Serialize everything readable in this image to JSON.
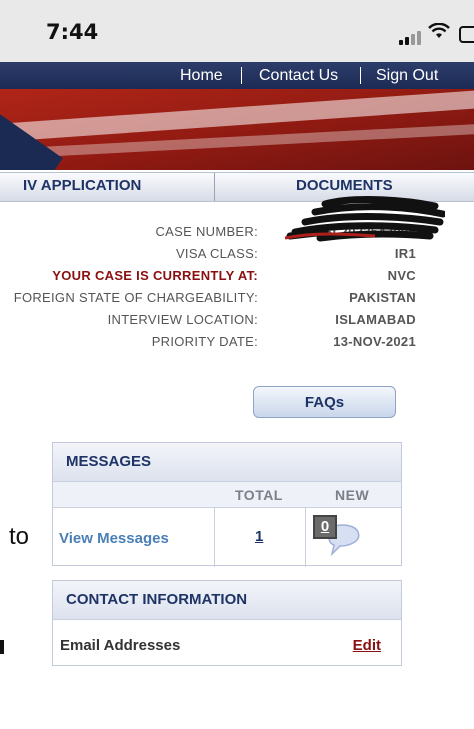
{
  "status_bar": {
    "time": "7:44"
  },
  "nav": {
    "items": [
      "Home",
      "Contact Us",
      "Sign Out"
    ]
  },
  "tabs": {
    "left": "IV APPLICATION",
    "right": "DOCUMENTS"
  },
  "case_info": {
    "case_number_label": "CASE NUMBER:",
    "case_number_value": "ISL2022543006",
    "visa_class_label": "VISA CLASS:",
    "visa_class_value": "IR1",
    "current_label": "YOUR CASE IS CURRENTLY AT:",
    "current_value": "NVC",
    "state_label": "FOREIGN STATE OF CHARGEABILITY:",
    "state_value": "PAKISTAN",
    "interview_label": "INTERVIEW LOCATION:",
    "interview_value": "ISLAMABAD",
    "priority_label": "PRIORITY DATE:",
    "priority_value": "13-NOV-2021"
  },
  "faq_button": "FAQs",
  "messages": {
    "title": "MESSAGES",
    "col_total": "TOTAL",
    "col_new": "NEW",
    "link": "View Messages",
    "total": "1",
    "new": "0"
  },
  "contact": {
    "title": "CONTACT INFORMATION",
    "email_label": "Email Addresses",
    "edit": "Edit"
  },
  "side_text": "to",
  "colors": {
    "navy": "#1f3466",
    "red": "#8a0f10",
    "link": "#4a7fb5"
  }
}
